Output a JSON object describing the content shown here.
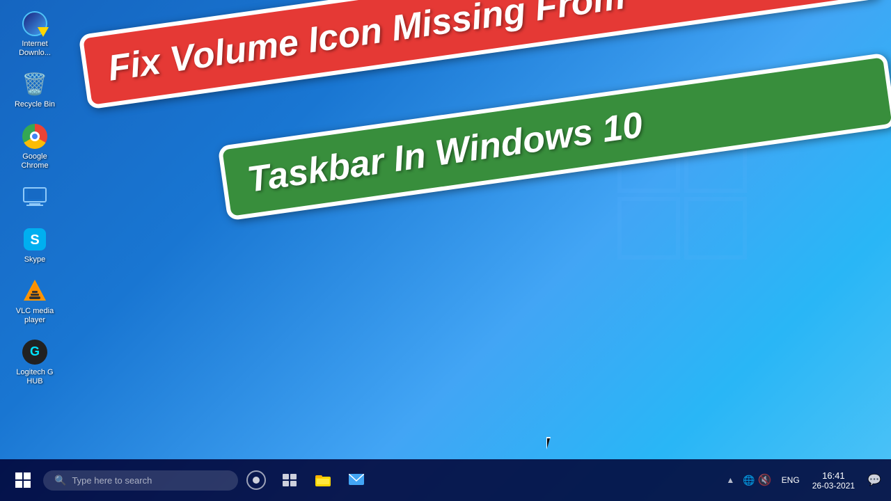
{
  "desktop": {
    "background": "Windows 10 blue gradient",
    "icons": [
      {
        "id": "internet-download-manager",
        "label": "Internet\nDownlo...",
        "type": "idm"
      },
      {
        "id": "recycle-bin",
        "label": "Recycle Bin",
        "type": "recycle"
      },
      {
        "id": "google-chrome",
        "label": "Google\nChrome",
        "type": "chrome"
      },
      {
        "id": "my-computer",
        "label": "",
        "type": "laptop"
      },
      {
        "id": "skype",
        "label": "Skype",
        "type": "skype"
      },
      {
        "id": "vlc-media-player",
        "label": "VLC media\nplayer",
        "type": "vlc"
      },
      {
        "id": "logitech-g-hub",
        "label": "Logitech G\nHUB",
        "type": "logitech"
      }
    ]
  },
  "overlay": {
    "line1": "Fix Volume Icon Missing From",
    "line2": "Taskbar In Windows 10"
  },
  "taskbar": {
    "search_placeholder": "Type here to search",
    "clock": {
      "time": "16:41",
      "date": "26-03-2021"
    },
    "language": "ENG",
    "icons": {
      "cortana_label": "Cortana",
      "taskview_label": "Task View",
      "fileexplorer_label": "File Explorer",
      "mail_label": "Mail"
    }
  }
}
